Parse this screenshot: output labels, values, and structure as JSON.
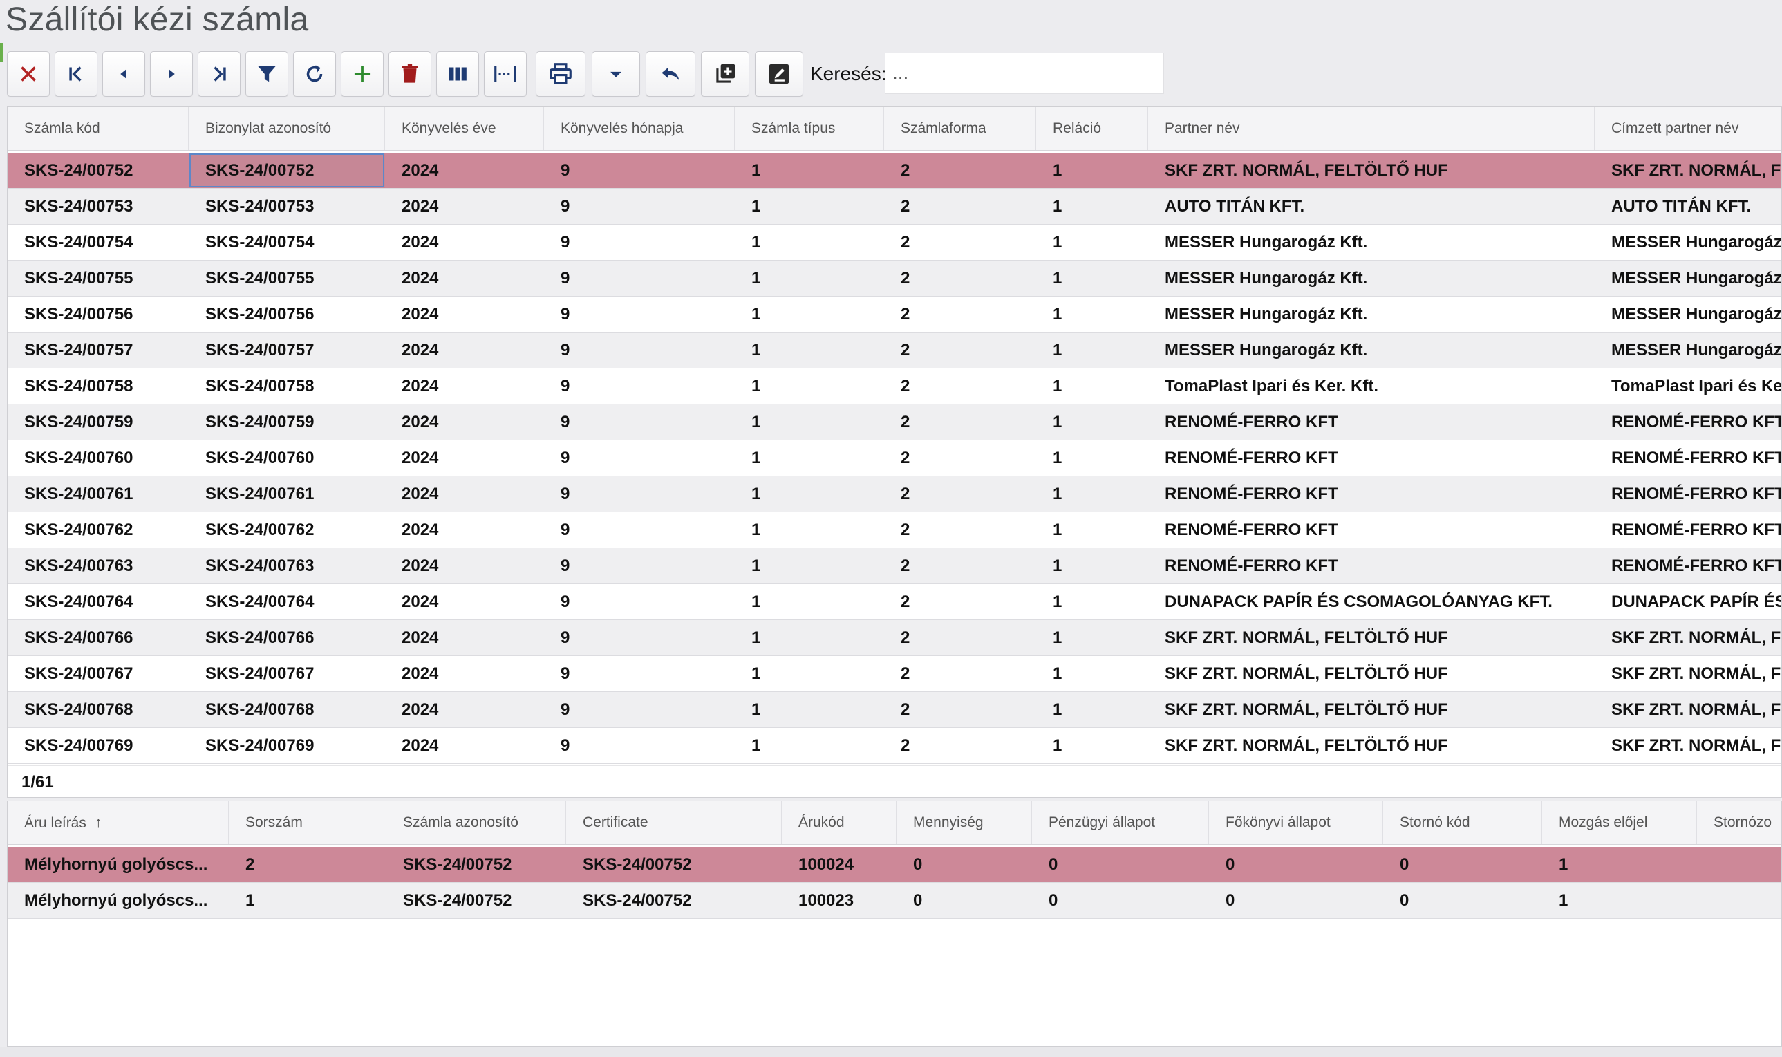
{
  "page": {
    "title": "Szállítói kézi számla"
  },
  "toolbar": {
    "buttons": [
      {
        "name": "close-button",
        "icon": "close-icon"
      },
      {
        "name": "first-record-button",
        "icon": "first-icon"
      },
      {
        "name": "prev-record-button",
        "icon": "prev-icon"
      },
      {
        "name": "next-record-button",
        "icon": "next-icon"
      },
      {
        "name": "last-record-button",
        "icon": "last-icon"
      },
      {
        "name": "filter-button",
        "icon": "filter-icon"
      },
      {
        "name": "refresh-button",
        "icon": "refresh-icon"
      },
      {
        "name": "add-button",
        "icon": "plus-icon"
      },
      {
        "name": "delete-button",
        "icon": "trash-icon"
      },
      {
        "name": "columns-button",
        "icon": "columns-icon"
      },
      {
        "name": "fit-columns-button",
        "icon": "fit-width-icon"
      },
      {
        "name": "print-button",
        "icon": "printer-icon"
      },
      {
        "name": "print-menu-button",
        "icon": "caret-down-icon"
      },
      {
        "name": "undo-button",
        "icon": "reply-icon"
      },
      {
        "name": "duplicate-button",
        "icon": "copy-add-icon"
      },
      {
        "name": "edit-button",
        "icon": "edit-icon"
      }
    ],
    "search_label": "Keresés:",
    "search_placeholder": "...",
    "search_value": ""
  },
  "colors": {
    "selected_row": "#cd8898",
    "alt_row": "#efeff1",
    "add_icon": "#2e8b2e",
    "delete_icon": "#a11c1c",
    "close_icon": "#b22222",
    "nav_icon": "#1f3b73"
  },
  "invoices": {
    "columns": [
      "Számla kód",
      "Bizonylat azonosító",
      "Könyvelés éve",
      "Könyvelés hónapja",
      "Számla típus",
      "Számlaforma",
      "Reláció",
      "Partner név",
      "Címzett partner név"
    ],
    "rows": [
      [
        "SKS-24/00752",
        "SKS-24/00752",
        "2024",
        "9",
        "1",
        "2",
        "1",
        "SKF ZRT. NORMÁL, FELTÖLTŐ HUF",
        "SKF ZRT. NORMÁL, F"
      ],
      [
        "SKS-24/00753",
        "SKS-24/00753",
        "2024",
        "9",
        "1",
        "2",
        "1",
        "AUTO TITÁN KFT.",
        "AUTO TITÁN KFT."
      ],
      [
        "SKS-24/00754",
        "SKS-24/00754",
        "2024",
        "9",
        "1",
        "2",
        "1",
        "MESSER Hungarogáz Kft.",
        "MESSER Hungarogáz"
      ],
      [
        "SKS-24/00755",
        "SKS-24/00755",
        "2024",
        "9",
        "1",
        "2",
        "1",
        "MESSER Hungarogáz Kft.",
        "MESSER Hungarogáz"
      ],
      [
        "SKS-24/00756",
        "SKS-24/00756",
        "2024",
        "9",
        "1",
        "2",
        "1",
        "MESSER Hungarogáz Kft.",
        "MESSER Hungarogáz"
      ],
      [
        "SKS-24/00757",
        "SKS-24/00757",
        "2024",
        "9",
        "1",
        "2",
        "1",
        "MESSER Hungarogáz Kft.",
        "MESSER Hungarogáz"
      ],
      [
        "SKS-24/00758",
        "SKS-24/00758",
        "2024",
        "9",
        "1",
        "2",
        "1",
        "TomaPlast Ipari és Ker. Kft.",
        "TomaPlast Ipari és Ke"
      ],
      [
        "SKS-24/00759",
        "SKS-24/00759",
        "2024",
        "9",
        "1",
        "2",
        "1",
        "RENOMÉ-FERRO KFT",
        "RENOMÉ-FERRO KFT"
      ],
      [
        "SKS-24/00760",
        "SKS-24/00760",
        "2024",
        "9",
        "1",
        "2",
        "1",
        "RENOMÉ-FERRO KFT",
        "RENOMÉ-FERRO KFT"
      ],
      [
        "SKS-24/00761",
        "SKS-24/00761",
        "2024",
        "9",
        "1",
        "2",
        "1",
        "RENOMÉ-FERRO KFT",
        "RENOMÉ-FERRO KFT"
      ],
      [
        "SKS-24/00762",
        "SKS-24/00762",
        "2024",
        "9",
        "1",
        "2",
        "1",
        "RENOMÉ-FERRO KFT",
        "RENOMÉ-FERRO KFT"
      ],
      [
        "SKS-24/00763",
        "SKS-24/00763",
        "2024",
        "9",
        "1",
        "2",
        "1",
        "RENOMÉ-FERRO KFT",
        "RENOMÉ-FERRO KFT"
      ],
      [
        "SKS-24/00764",
        "SKS-24/00764",
        "2024",
        "9",
        "1",
        "2",
        "1",
        "DUNAPACK PAPÍR ÉS CSOMAGOLÓANYAG KFT.",
        "DUNAPACK PAPÍR ÉS"
      ],
      [
        "SKS-24/00766",
        "SKS-24/00766",
        "2024",
        "9",
        "1",
        "2",
        "1",
        "SKF ZRT. NORMÁL, FELTÖLTŐ HUF",
        "SKF ZRT. NORMÁL, F"
      ],
      [
        "SKS-24/00767",
        "SKS-24/00767",
        "2024",
        "9",
        "1",
        "2",
        "1",
        "SKF ZRT. NORMÁL, FELTÖLTŐ HUF",
        "SKF ZRT. NORMÁL, F"
      ],
      [
        "SKS-24/00768",
        "SKS-24/00768",
        "2024",
        "9",
        "1",
        "2",
        "1",
        "SKF ZRT. NORMÁL, FELTÖLTŐ HUF",
        "SKF ZRT. NORMÁL, F"
      ],
      [
        "SKS-24/00769",
        "SKS-24/00769",
        "2024",
        "9",
        "1",
        "2",
        "1",
        "SKF ZRT. NORMÁL, FELTÖLTŐ HUF",
        "SKF ZRT. NORMÁL, F"
      ]
    ],
    "pager": "1/61"
  },
  "items": {
    "columns": [
      "Áru leírás",
      "Sorszám",
      "Számla azonosító",
      "Certificate",
      "Árukód",
      "Mennyiség",
      "Pénzügyi állapot",
      "Főkönyvi állapot",
      "Stornó kód",
      "Mozgás előjel",
      "Stornózo"
    ],
    "sort_icon": "arrow-up-icon",
    "rows": [
      [
        "Mélyhornyú golyóscs...",
        "2",
        "SKS-24/00752",
        "SKS-24/00752",
        "100024",
        "0",
        "0",
        "0",
        "0",
        "1",
        ""
      ],
      [
        "Mélyhornyú golyóscs...",
        "1",
        "SKS-24/00752",
        "SKS-24/00752",
        "100023",
        "0",
        "0",
        "0",
        "0",
        "1",
        ""
      ]
    ]
  }
}
